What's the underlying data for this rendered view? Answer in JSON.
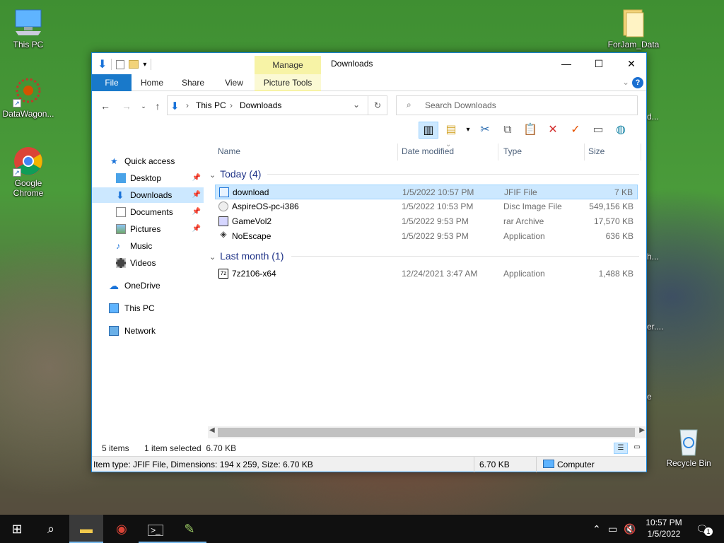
{
  "desktop": {
    "icons": [
      {
        "label": "This PC"
      },
      {
        "label": "DataWagon..."
      },
      {
        "label": "Google Chrome"
      },
      {
        "label": "ForJam_Data"
      },
      {
        "label": "Recycle Bin"
      }
    ],
    "edge_labels": [
      "d...",
      "h...",
      "er....",
      "e"
    ]
  },
  "window": {
    "title": "Downloads",
    "manage_label": "Manage",
    "tabs": [
      "File",
      "Home",
      "Share",
      "View",
      "Picture Tools"
    ],
    "controls": {
      "minimize": "—",
      "maximize": "☐",
      "close": "✕"
    },
    "help": "?"
  },
  "address": {
    "crumbs": [
      "This PC",
      "Downloads"
    ],
    "search_placeholder": "Search Downloads"
  },
  "nav": {
    "items": [
      {
        "label": "Quick access"
      },
      {
        "label": "Desktop"
      },
      {
        "label": "Downloads"
      },
      {
        "label": "Documents"
      },
      {
        "label": "Pictures"
      },
      {
        "label": "Music"
      },
      {
        "label": "Videos"
      },
      {
        "label": "OneDrive"
      },
      {
        "label": "This PC"
      },
      {
        "label": "Network"
      }
    ]
  },
  "columns": [
    "Name",
    "Date modified",
    "Type",
    "Size"
  ],
  "groups": [
    {
      "label": "Today (4)",
      "files": [
        {
          "name": "download",
          "date": "1/5/2022 10:57 PM",
          "type": "JFIF File",
          "size": "7 KB"
        },
        {
          "name": "AspireOS-pc-i386",
          "date": "1/5/2022 10:53 PM",
          "type": "Disc Image File",
          "size": "549,156 KB"
        },
        {
          "name": "GameVol2",
          "date": "1/5/2022 9:53 PM",
          "type": "rar Archive",
          "size": "17,570 KB"
        },
        {
          "name": "NoEscape",
          "date": "1/5/2022 9:53 PM",
          "type": "Application",
          "size": "636 KB"
        }
      ]
    },
    {
      "label": "Last month (1)",
      "files": [
        {
          "name": "7z2106-x64",
          "date": "12/24/2021 3:47 AM",
          "type": "Application",
          "size": "1,488 KB"
        }
      ]
    }
  ],
  "status": {
    "items": "5 items",
    "selected": "1 item selected  6.70 KB"
  },
  "details": {
    "info": "Item type: JFIF File, Dimensions: 194 x 259, Size: 6.70 KB",
    "size": "6.70 KB",
    "location": "Computer"
  },
  "taskbar": {
    "time": "10:57 PM",
    "date": "1/5/2022",
    "notif_count": "1"
  },
  "colors": {
    "accent": "#1979ca",
    "selection": "#cce8ff",
    "manage": "#f7f3a6"
  }
}
